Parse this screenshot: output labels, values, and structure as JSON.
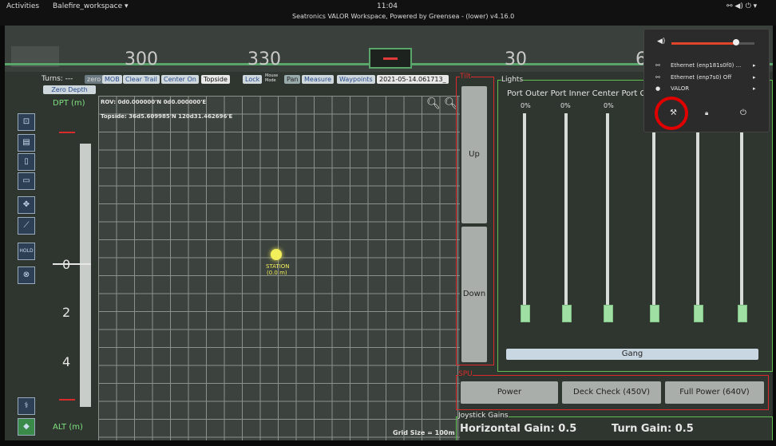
{
  "topbar": {
    "activities": "Activities",
    "workspace": "Balefire_workspace ▾",
    "clock": "11:04",
    "window_title": "Seatronics VALOR Workspace, Powered by Greensea - (lower) v4.16.0"
  },
  "heading": {
    "ticks": [
      "300",
      "330",
      "30",
      "6"
    ]
  },
  "toolbar": {
    "turns": "Turns: ---",
    "zero": "zero",
    "mob": "MOB",
    "clear_trail": "Clear Trail",
    "center_on": "Center On",
    "topside": "Topside",
    "lock": "Lock",
    "mouse_mode": "Mouse Mode",
    "pan": "Pan",
    "measure": "Measure",
    "waypoints": "Waypoints",
    "date": "2021-05-14.061713_"
  },
  "depth": {
    "zero_depth": "Zero Depth",
    "dpt_label": "DPT (m)",
    "alt_label": "ALT (m)",
    "marks": [
      "0",
      "2",
      "4"
    ]
  },
  "map": {
    "rov": "ROV: 0d0.000000'N 0d0.000000'E",
    "topside": "Topside: 36d5.609985'N 120d31.462696'E",
    "station": "STATION",
    "station_depth": "(0.0 m)",
    "grid_size": "Grid Size = 100m"
  },
  "tilt": {
    "title": "Tilt",
    "up": "Up",
    "down": "Down"
  },
  "lights": {
    "title": "Lights",
    "headers": "Port Outer Port Inner Center Port Cer",
    "percents": [
      "0%",
      "0%",
      "0%"
    ],
    "gang": "Gang"
  },
  "spu": {
    "title": "SPU",
    "power": "Power",
    "deck_check": "Deck Check (450V)",
    "full_power": "Full Power (640V)"
  },
  "gains": {
    "title": "Joystick Gains",
    "horizontal": "Horizontal Gain: 0.5",
    "turn": "Turn Gain: 0.5"
  },
  "menu": {
    "eth1": "Ethernet (enp181s0f0) ...",
    "eth2": "Ethernet (enp7s0) Off",
    "user": "VALOR",
    "volume_fraction": 0.78
  },
  "colors": {
    "accent_red": "#d92b2b",
    "accent_green": "#5fbf4f",
    "knob": "#9fdfa4",
    "highlight_circle": "#e00000"
  }
}
